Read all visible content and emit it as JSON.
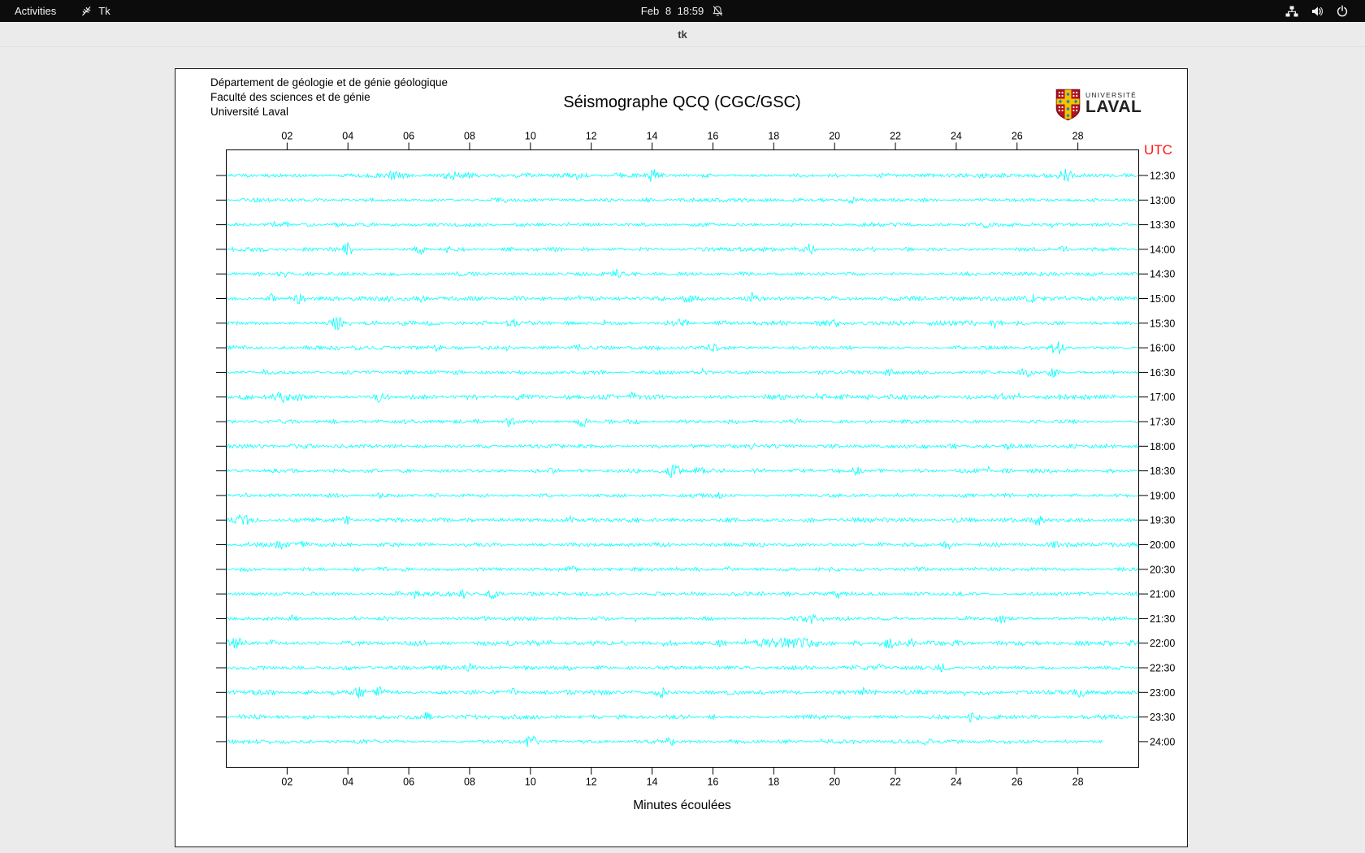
{
  "topbar": {
    "activities_label": "Activities",
    "app_name": "Tk",
    "clock": "Feb 8 18:59",
    "icons": [
      "tk-app-icon",
      "notifications-disabled-icon",
      "network-icon",
      "volume-icon",
      "power-icon"
    ]
  },
  "titlebar": {
    "title": "tk",
    "buttons": [
      "minimize",
      "maximize",
      "close"
    ]
  },
  "canvas": {
    "header_lines": [
      "Département de géologie et de génie géologique",
      "Faculté des sciences et de génie",
      "Université Laval"
    ],
    "title": "Séismographe QCQ (CGC/GSC)",
    "utc_label": "UTC",
    "xlabel": "Minutes écoulées",
    "logo": {
      "line_small": "UNIVERSITÉ",
      "line_big": "LAVAL"
    }
  },
  "colors": {
    "trace": "#00ffff",
    "axis": "#000000",
    "utc": "#ff1414",
    "logo_red": "#b5121b",
    "logo_gold": "#f2c400",
    "logo_blue": "#1e7fc2"
  },
  "chart_data": {
    "type": "line",
    "title": "Séismographe QCQ (CGC/GSC)",
    "xlabel": "Minutes écoulées",
    "ylabel": "UTC",
    "x_range": [
      0,
      30
    ],
    "x_ticks": [
      "02",
      "04",
      "06",
      "08",
      "10",
      "12",
      "14",
      "16",
      "18",
      "20",
      "22",
      "24",
      "26",
      "28"
    ],
    "grid": false,
    "legend": "none",
    "rows": [
      {
        "time": "12:30",
        "noise_amp": 2.0,
        "end_min": 30,
        "bursts": [
          [
            5.5,
            3,
            0.3
          ],
          [
            7.5,
            3.5,
            0.35
          ],
          [
            11.5,
            3.5,
            0.1
          ],
          [
            14.0,
            7,
            0.12
          ],
          [
            27.6,
            8,
            0.15
          ]
        ]
      },
      {
        "time": "13:00",
        "noise_amp": 1.7,
        "end_min": 30,
        "bursts": [
          [
            9,
            2.5,
            0.15
          ],
          [
            20.5,
            3,
            0.1
          ]
        ]
      },
      {
        "time": "13:30",
        "noise_amp": 1.7,
        "end_min": 30,
        "bursts": [
          [
            2,
            2.5,
            0.1
          ],
          [
            25,
            3,
            0.1
          ]
        ]
      },
      {
        "time": "14:00",
        "noise_amp": 1.9,
        "end_min": 30,
        "bursts": [
          [
            4.0,
            7,
            0.12
          ],
          [
            6.4,
            4.5,
            0.1
          ],
          [
            7.3,
            4.5,
            0.1
          ],
          [
            19.2,
            6,
            0.12
          ],
          [
            27.5,
            3.5,
            0.1
          ]
        ]
      },
      {
        "time": "14:30",
        "noise_amp": 1.8,
        "end_min": 30,
        "bursts": [
          [
            2,
            2.5,
            0.1
          ],
          [
            12.8,
            4.5,
            0.1
          ]
        ]
      },
      {
        "time": "15:00",
        "noise_amp": 2.1,
        "end_min": 30,
        "bursts": [
          [
            1.5,
            4.5,
            0.1
          ],
          [
            2.4,
            5.5,
            0.12
          ],
          [
            5.5,
            3.5,
            0.1
          ],
          [
            6.4,
            4.5,
            0.1
          ],
          [
            15.2,
            5.5,
            0.1
          ],
          [
            17.3,
            5.5,
            0.1
          ],
          [
            26.5,
            4.5,
            0.1
          ]
        ]
      },
      {
        "time": "15:30",
        "noise_amp": 2.1,
        "end_min": 30,
        "bursts": [
          [
            3.6,
            7.5,
            0.14
          ],
          [
            9.4,
            4.5,
            0.1
          ],
          [
            12.4,
            4,
            0.1
          ],
          [
            15,
            4,
            0.1
          ],
          [
            20,
            3,
            0.1
          ],
          [
            25.3,
            4.5,
            0.1
          ]
        ]
      },
      {
        "time": "16:00",
        "noise_amp": 1.9,
        "end_min": 30,
        "bursts": [
          [
            7,
            3.5,
            0.1
          ],
          [
            11.6,
            3.5,
            0.1
          ],
          [
            16,
            4.5,
            0.1
          ],
          [
            27.3,
            6.5,
            0.14
          ]
        ]
      },
      {
        "time": "16:30",
        "noise_amp": 1.8,
        "end_min": 30,
        "bursts": [
          [
            21.8,
            3,
            0.1
          ],
          [
            26.3,
            4.5,
            0.12
          ],
          [
            27.2,
            6.5,
            0.12
          ]
        ]
      },
      {
        "time": "17:00",
        "noise_amp": 2.2,
        "end_min": 30,
        "bursts": [
          [
            1.8,
            4.5,
            0.25
          ],
          [
            2.4,
            4.5,
            0.1
          ],
          [
            5,
            3.5,
            0.1
          ],
          [
            9.7,
            4.5,
            0.1
          ],
          [
            13.4,
            5.5,
            0.1
          ],
          [
            19.5,
            3.5,
            0.1
          ]
        ]
      },
      {
        "time": "17:30",
        "noise_amp": 1.8,
        "end_min": 30,
        "bursts": [
          [
            8.3,
            4.5,
            0.1
          ],
          [
            9.3,
            4.5,
            0.1
          ],
          [
            11.7,
            5.5,
            0.1
          ]
        ]
      },
      {
        "time": "18:00",
        "noise_amp": 1.8,
        "end_min": 30,
        "bursts": [
          [
            17.3,
            3,
            0.1
          ],
          [
            23.9,
            4.5,
            0.1
          ],
          [
            25.7,
            3.5,
            0.1
          ]
        ]
      },
      {
        "time": "18:30",
        "noise_amp": 1.9,
        "end_min": 30,
        "bursts": [
          [
            10.8,
            3.5,
            0.1
          ],
          [
            14.7,
            7.5,
            0.18
          ],
          [
            15.5,
            4.5,
            0.14
          ],
          [
            20.7,
            3.5,
            0.1
          ]
        ]
      },
      {
        "time": "19:00",
        "noise_amp": 1.7,
        "end_min": 30,
        "bursts": [
          [
            5,
            2.5,
            0.1
          ],
          [
            16.2,
            2.5,
            0.1
          ]
        ]
      },
      {
        "time": "19:30",
        "noise_amp": 2.0,
        "end_min": 30,
        "bursts": [
          [
            0.5,
            3.5,
            0.3
          ],
          [
            4,
            3.5,
            0.1
          ],
          [
            11.3,
            4.5,
            0.1
          ],
          [
            26.7,
            5.5,
            0.18
          ]
        ]
      },
      {
        "time": "20:00",
        "noise_amp": 1.9,
        "end_min": 30,
        "bursts": [
          [
            1.8,
            3.5,
            0.2
          ],
          [
            2.5,
            3.5,
            0.1
          ],
          [
            23.7,
            3.5,
            0.1
          ],
          [
            27.2,
            4.5,
            0.15
          ]
        ]
      },
      {
        "time": "20:30",
        "noise_amp": 1.8,
        "end_min": 30,
        "bursts": [
          [
            11.3,
            3.5,
            0.1
          ],
          [
            16.5,
            2.5,
            0.1
          ]
        ]
      },
      {
        "time": "21:00",
        "noise_amp": 1.9,
        "end_min": 30,
        "bursts": [
          [
            6.2,
            3.5,
            0.1
          ],
          [
            7.8,
            4.5,
            0.1
          ],
          [
            8.7,
            4.5,
            0.1
          ],
          [
            19.5,
            3.5,
            0.1
          ],
          [
            20.1,
            3.5,
            0.1
          ]
        ]
      },
      {
        "time": "21:30",
        "noise_amp": 1.8,
        "end_min": 30,
        "bursts": [
          [
            2.2,
            2.5,
            0.1
          ],
          [
            19.2,
            5.5,
            0.14
          ],
          [
            25.5,
            4.5,
            0.1
          ]
        ]
      },
      {
        "time": "22:00",
        "noise_amp": 2.2,
        "end_min": 30,
        "bursts": [
          [
            0.3,
            5.5,
            0.2
          ],
          [
            1.5,
            3.5,
            0.1
          ],
          [
            16.3,
            3.5,
            0.1
          ],
          [
            18.2,
            6,
            0.45
          ],
          [
            19,
            5,
            0.25
          ],
          [
            21.8,
            4.5,
            0.1
          ],
          [
            22.5,
            3.5,
            0.1
          ],
          [
            24,
            3.5,
            0.1
          ]
        ]
      },
      {
        "time": "22:30",
        "noise_amp": 1.9,
        "end_min": 30,
        "bursts": [
          [
            8,
            3.5,
            0.1
          ],
          [
            11.3,
            2.5,
            0.1
          ],
          [
            21.5,
            3.5,
            0.1
          ],
          [
            23.6,
            4.5,
            0.12
          ]
        ]
      },
      {
        "time": "23:00",
        "noise_amp": 2.1,
        "end_min": 30,
        "bursts": [
          [
            4.4,
            5.5,
            0.12
          ],
          [
            5,
            4.5,
            0.1
          ],
          [
            9.4,
            4.5,
            0.1
          ],
          [
            14.3,
            5.5,
            0.12
          ],
          [
            21,
            3.5,
            0.1
          ],
          [
            28,
            3.5,
            0.18
          ]
        ]
      },
      {
        "time": "23:30",
        "noise_amp": 1.9,
        "end_min": 30,
        "bursts": [
          [
            6.6,
            4.5,
            0.1
          ],
          [
            16,
            2.5,
            0.1
          ],
          [
            24.5,
            5.5,
            0.14
          ]
        ]
      },
      {
        "time": "24:00",
        "noise_amp": 1.9,
        "end_min": 28.8,
        "bursts": [
          [
            10,
            5.5,
            0.14
          ],
          [
            14.6,
            4.5,
            0.1
          ],
          [
            23,
            4.5,
            0.12
          ]
        ]
      }
    ]
  }
}
